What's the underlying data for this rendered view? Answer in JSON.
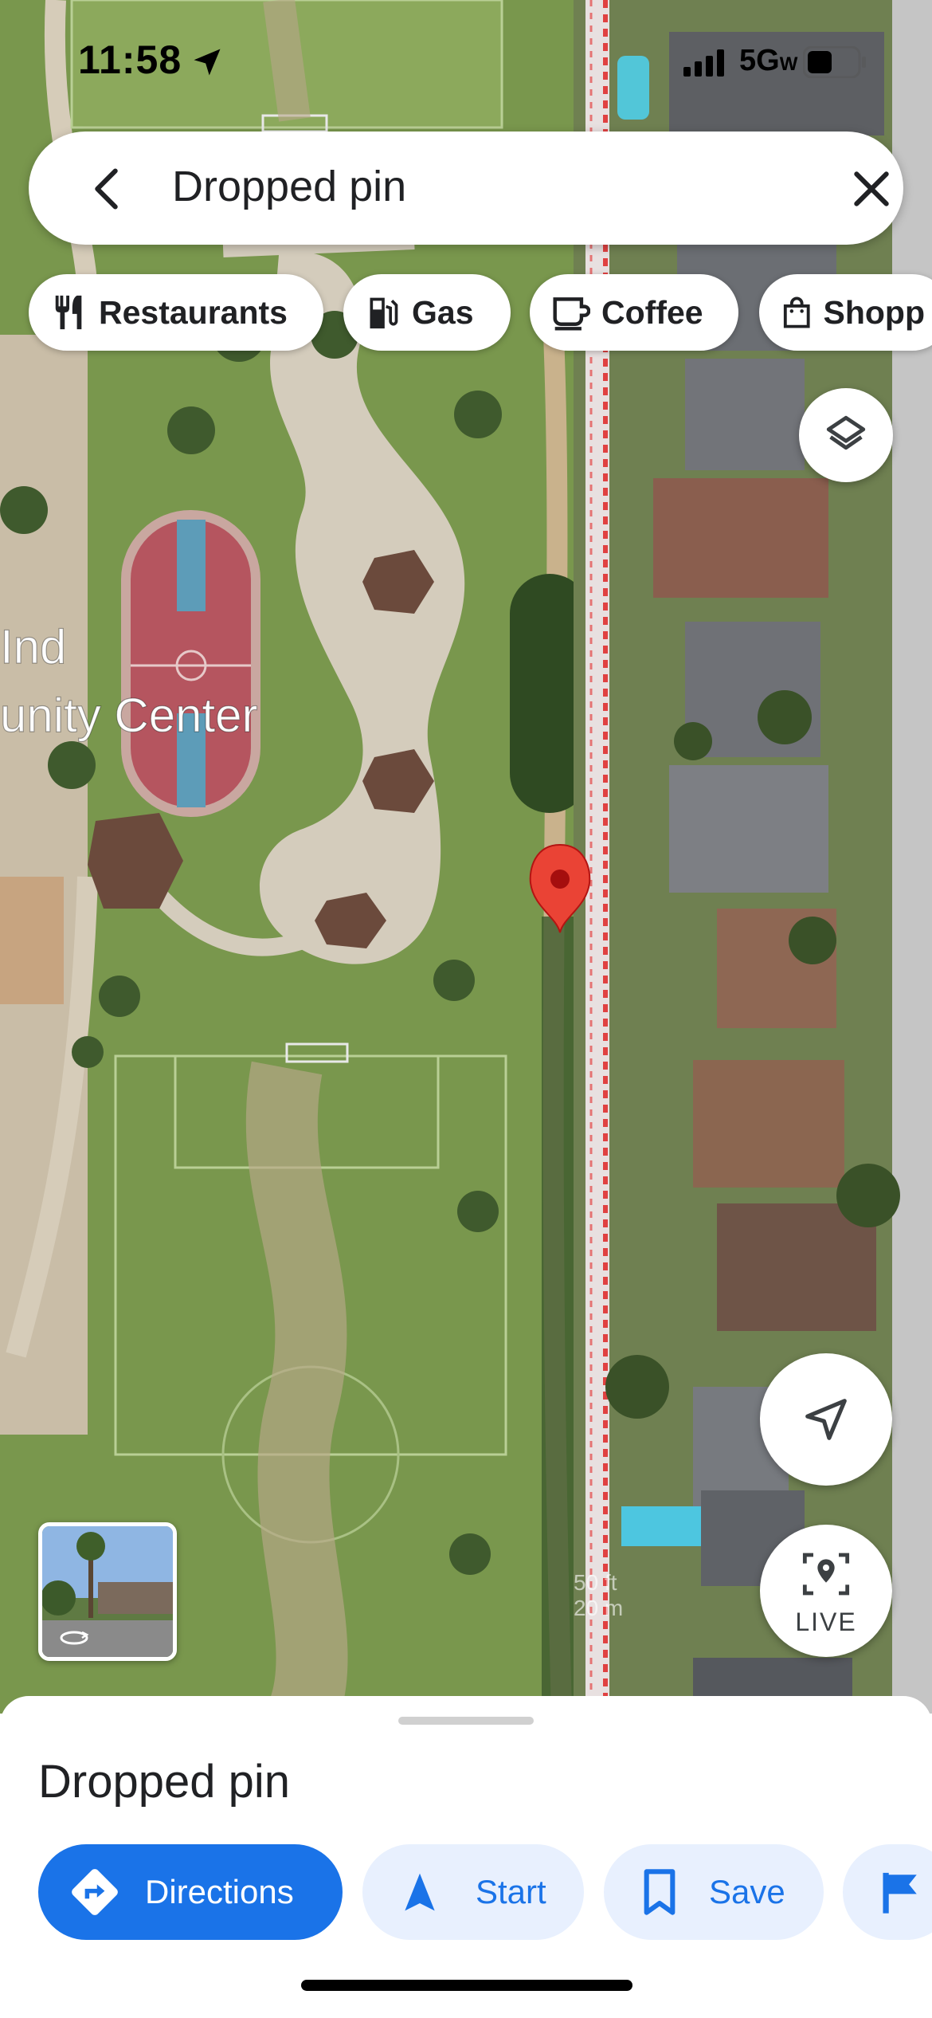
{
  "status_bar": {
    "time": "11:58",
    "network": "5G",
    "network_sub": "W"
  },
  "search": {
    "title": "Dropped pin",
    "back_icon": "chevron-left-icon",
    "clear_icon": "close-icon"
  },
  "chips": [
    {
      "label": "Restaurants",
      "icon": "fork-knife-icon"
    },
    {
      "label": "Gas",
      "icon": "gas-pump-icon"
    },
    {
      "label": "Coffee",
      "icon": "coffee-cup-icon"
    },
    {
      "label": "Shopp",
      "icon": "shopping-bag-icon"
    }
  ],
  "map": {
    "place_label_line1": "Ind",
    "place_label_line2": "unity Center",
    "scale_ft": "50 ft",
    "scale_m": "20 m"
  },
  "fabs": {
    "layers_icon": "layers-icon",
    "recenter_icon": "navigation-arrow-icon",
    "live_label": "LIVE"
  },
  "sheet": {
    "place_title": "Dropped pin",
    "actions": [
      {
        "label": "Directions",
        "icon": "directions-icon"
      },
      {
        "label": "Start",
        "icon": "navigation-icon"
      },
      {
        "label": "Save",
        "icon": "bookmark-icon"
      },
      {
        "label": "",
        "icon": "flag-icon"
      }
    ]
  },
  "colors": {
    "accent": "#1a73e8",
    "tonal_button": "#e8f0fe",
    "pin": "#ea4335",
    "grass": "#7d9a4f"
  }
}
